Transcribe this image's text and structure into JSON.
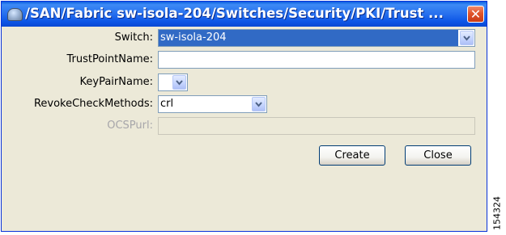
{
  "window": {
    "title": "/SAN/Fabric sw-isola-204/Switches/Security/PKI/Trust ...",
    "close_symbol": "✕"
  },
  "form": {
    "switch_label": "Switch:",
    "switch_value": "sw-isola-204",
    "trustpoint_label": "TrustPointName:",
    "trustpoint_value": "",
    "keypair_label": "KeyPairName:",
    "keypair_value": "",
    "revoke_label": "RevokeCheckMethods:",
    "revoke_value": "crl",
    "ocsp_label": "OCSPurl:",
    "ocsp_value": ""
  },
  "buttons": {
    "create_label": "Create",
    "close_label": "Close"
  },
  "watermark": "154324",
  "icons": {
    "app": "fabric-manager-app-icon",
    "close": "close-icon",
    "dropdown": "chevron-down-icon"
  },
  "colors": {
    "titlebar": "#2a73ef",
    "selection": "#316ac5",
    "close_button": "#e0552c",
    "window_bg": "#ece9d8"
  }
}
